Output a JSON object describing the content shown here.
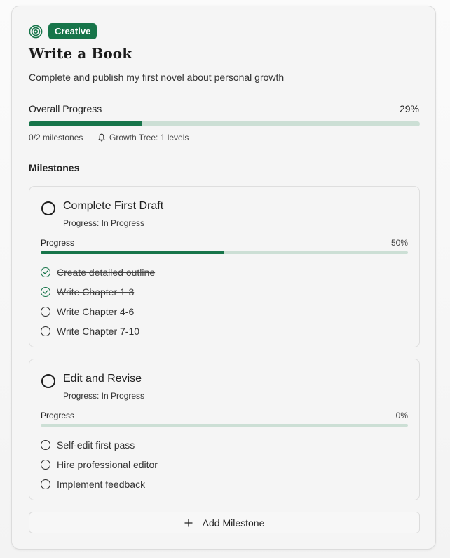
{
  "goal": {
    "icon": "target-icon",
    "badge": "Creative",
    "title": "Write a Book",
    "description": "Complete and publish my first novel about personal growth",
    "progress_label": "Overall Progress",
    "progress_percent_text": "29%",
    "progress_fraction": 0.29,
    "milestones_count": "0/2 milestones",
    "growth_icon": "bell-icon",
    "growth_tree": "Growth Tree: 1 levels"
  },
  "milestones_heading": "Milestones",
  "milestones": [
    {
      "title": "Complete First Draft",
      "status": "Progress: In Progress",
      "progress_label": "Progress",
      "progress_percent_text": "50%",
      "progress_fraction": 0.5,
      "tasks": [
        {
          "label": "Create detailed outline",
          "done": true
        },
        {
          "label": "Write Chapter 1-3",
          "done": true
        },
        {
          "label": "Write Chapter 4-6",
          "done": false
        },
        {
          "label": "Write Chapter 7-10",
          "done": false
        }
      ]
    },
    {
      "title": "Edit and Revise",
      "status": "Progress: In Progress",
      "progress_label": "Progress",
      "progress_percent_text": "0%",
      "progress_fraction": 0,
      "tasks": [
        {
          "label": "Self-edit first pass",
          "done": false
        },
        {
          "label": "Hire professional editor",
          "done": false
        },
        {
          "label": "Implement feedback",
          "done": false
        }
      ]
    }
  ],
  "add_milestone": {
    "label": "Add Milestone",
    "icon": "plus-icon"
  },
  "colors": {
    "accent": "#17754a",
    "track": "#ccdfd5",
    "card_bg": "#f5f5f5"
  }
}
